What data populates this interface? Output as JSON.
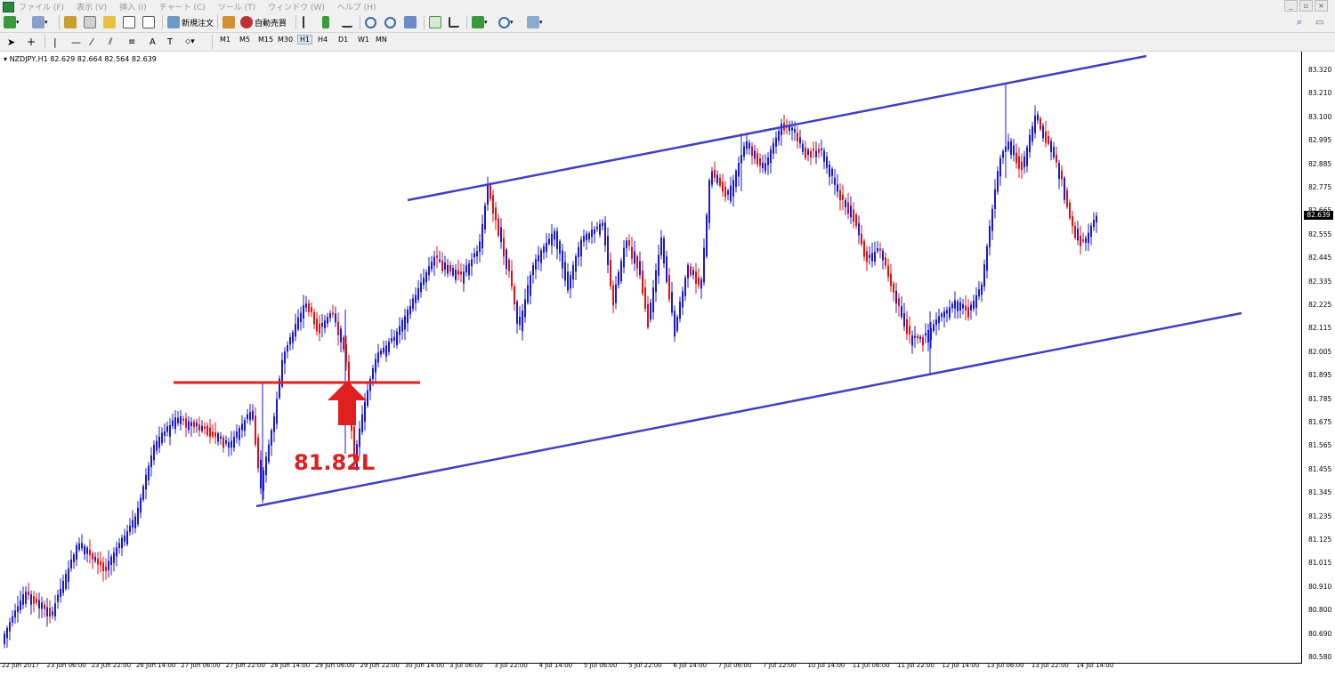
{
  "menubar": {
    "items": [
      "ファイル (F)",
      "表示 (V)",
      "挿入 (I)",
      "チャート (C)",
      "ツール (T)",
      "ウィンドウ (W)",
      "ヘルプ (H)"
    ]
  },
  "toolbar": {
    "new_order_label": "新規注文",
    "auto_trading_label": "自動売買",
    "timeframes": [
      "M1",
      "M5",
      "M15",
      "M30",
      "H1",
      "H4",
      "D1",
      "W1",
      "MN"
    ]
  },
  "chart": {
    "symbol_info": "NZDJPY,H1  82.629 82.664 82.564 82.639",
    "current_price": "82.639",
    "annotation": "81.82L",
    "price_labels": [
      "83.320",
      "83.210",
      "83.100",
      "82.995",
      "82.885",
      "82.775",
      "82.665",
      "82.555",
      "82.445",
      "82.335",
      "82.225",
      "82.115",
      "82.005",
      "81.895",
      "81.785",
      "81.675",
      "81.565",
      "81.455",
      "81.345",
      "81.235",
      "81.125",
      "81.015",
      "80.910",
      "80.800",
      "80.690",
      "80.580"
    ],
    "date_labels": [
      "22 Jun 2017",
      "23 Jun 06:00",
      "23 Jun 22:00",
      "26 Jun 14:00",
      "27 Jun 06:00",
      "27 Jun 22:00",
      "28 Jun 14:00",
      "29 Jun 06:00",
      "29 Jun 22:00",
      "30 Jun 14:00",
      "3 Jul 06:00",
      "3 Jul 22:00",
      "4 Jul 14:00",
      "5 Jul 06:00",
      "5 Jul 22:00",
      "6 Jul 14:00",
      "7 Jul 06:00",
      "7 Jul 22:00",
      "10 Jul 14:00",
      "11 Jul 06:00",
      "11 Jul 22:00",
      "12 Jul 14:00",
      "13 Jul 06:00",
      "13 Jul 22:00",
      "14 Jul 14:00"
    ],
    "colors": {
      "bull": "#1a1acc",
      "bear": "#e01010",
      "channel": "#4040c0",
      "level": "#e02020"
    }
  }
}
